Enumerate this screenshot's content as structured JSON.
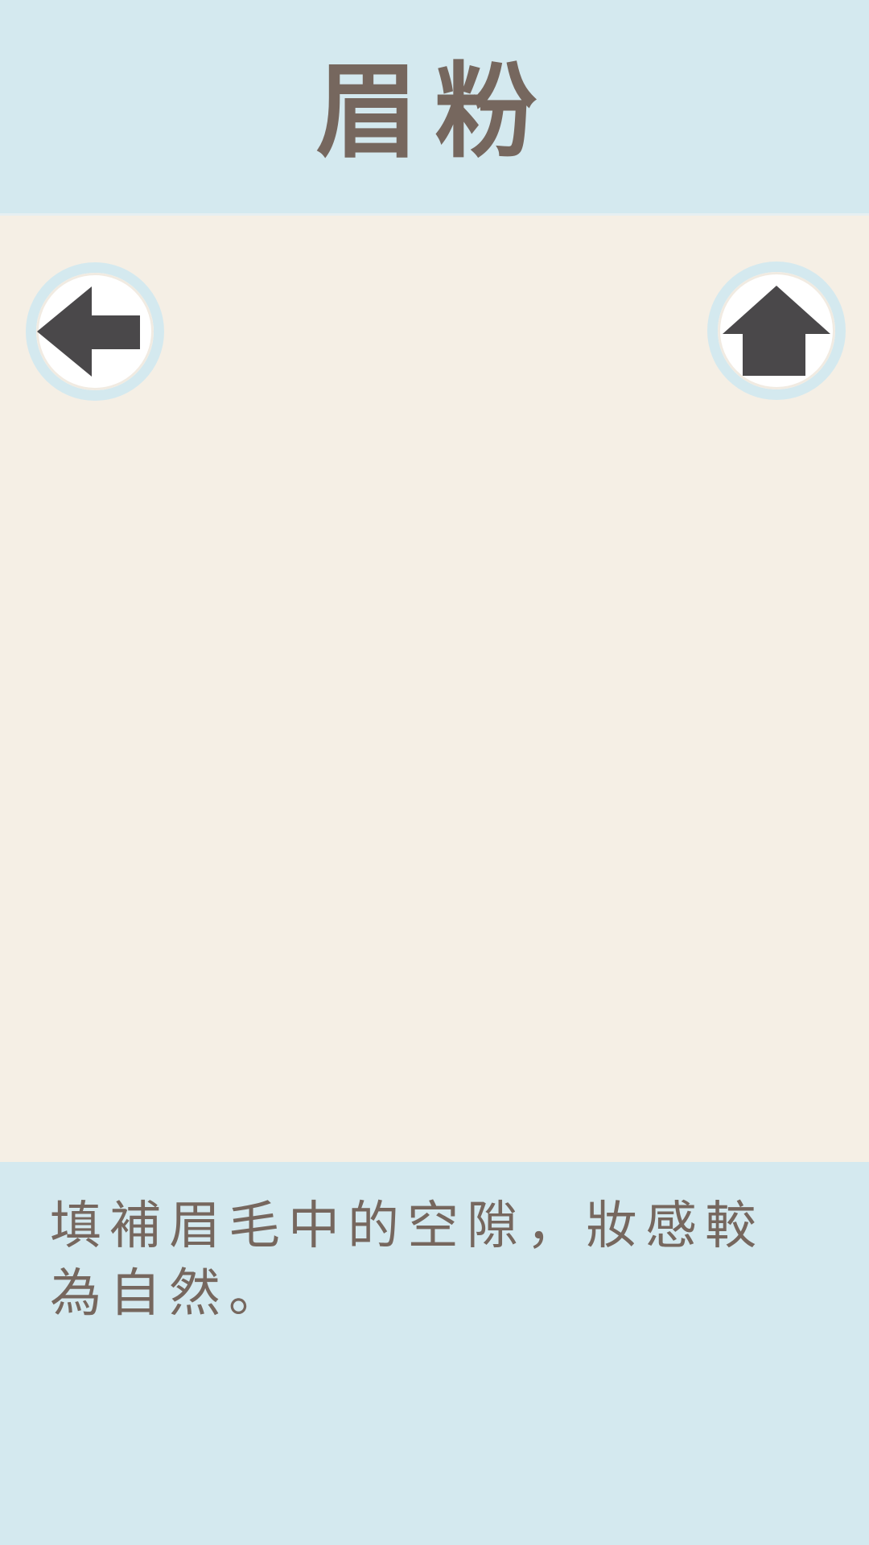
{
  "header": {
    "title": "眉粉"
  },
  "controls": {
    "back_icon": "arrow-left-icon",
    "home_icon": "arrow-up-icon"
  },
  "footer": {
    "description": "填補眉毛中的空隙，妝感較為自然。"
  },
  "colors": {
    "header_bg": "#d4e9ef",
    "content_bg": "#f5efe5",
    "text": "#76675e",
    "icon": "#4a484a"
  }
}
